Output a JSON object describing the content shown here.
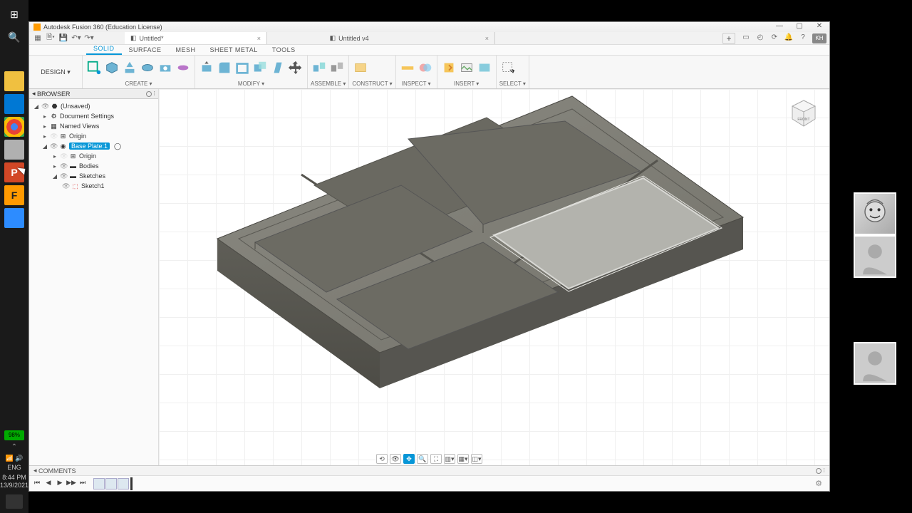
{
  "taskbar": {
    "battery": "98%",
    "lang": "ENG",
    "time": "8:44 PM",
    "date": "13/9/2021"
  },
  "title": "Autodesk Fusion 360 (Education License)",
  "tabs": [
    {
      "label": "Untitled*",
      "active": true
    },
    {
      "label": "Untitled v4",
      "active": false
    }
  ],
  "userBadge": "KH",
  "ribbonTabs": [
    "SOLID",
    "SURFACE",
    "MESH",
    "SHEET METAL",
    "TOOLS"
  ],
  "activeRibbonTab": "SOLID",
  "workspace": "DESIGN ▾",
  "groups": [
    "CREATE ▾",
    "",
    "MODIFY ▾",
    "",
    "ASSEMBLE ▾",
    "CONSTRUCT ▾",
    "INSPECT ▾",
    "INSERT ▾",
    "SELECT ▾"
  ],
  "browser": {
    "title": "BROWSER",
    "root": "(Unsaved)",
    "nodes": {
      "docSettings": "Document Settings",
      "namedViews": "Named Views",
      "origin": "Origin",
      "basePlate": "Base Plate:1",
      "bpOrigin": "Origin",
      "bodies": "Bodies",
      "sketches": "Sketches",
      "sketch1": "Sketch1"
    }
  },
  "comments": "COMMENTS"
}
